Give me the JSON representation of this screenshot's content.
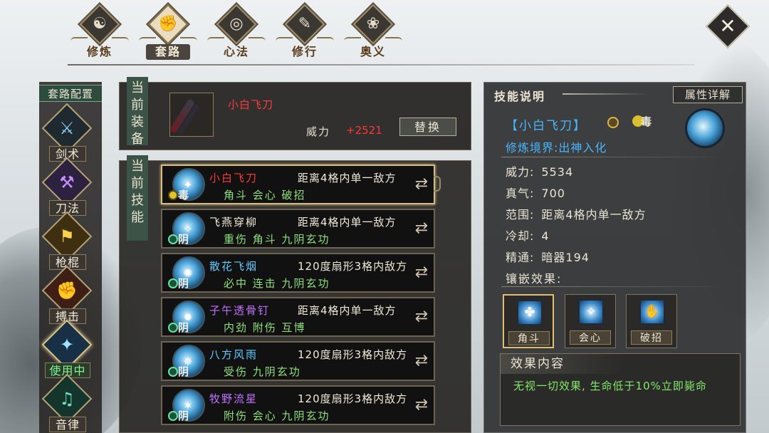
{
  "top_tabs": [
    {
      "label": "修炼",
      "icon": "☯",
      "active": false
    },
    {
      "label": "套路",
      "icon": "✊",
      "active": true
    },
    {
      "label": "心法",
      "icon": "◎",
      "active": false
    },
    {
      "label": "修行",
      "icon": "✎",
      "active": false
    },
    {
      "label": "奥义",
      "icon": "❀",
      "active": false
    }
  ],
  "close_icon": "✕",
  "sidebar": {
    "title": "套路配置",
    "categories": [
      {
        "label": "剑术",
        "icon": "⚔",
        "status": "normal"
      },
      {
        "label": "刀法",
        "icon": "⚒",
        "status": "normal"
      },
      {
        "label": "枪棍",
        "icon": "⚑",
        "status": "normal"
      },
      {
        "label": "搏击",
        "icon": "✊",
        "status": "normal"
      },
      {
        "label": "使用中",
        "icon": "✦",
        "status": "using"
      },
      {
        "label": "音律",
        "icon": "♫",
        "status": "normal"
      }
    ]
  },
  "equipment": {
    "vertical_label": "当前装备",
    "weapon_name": "小白飞刀",
    "power_label": "威力",
    "power_value": "+2521",
    "replace_button": "替换"
  },
  "skills": {
    "vertical_label": "当前技能",
    "items": [
      {
        "name": "小白飞刀",
        "name_color": "#ff3b3b",
        "range": "距离4格内单一敌方",
        "tags": "角斗 会心 破招",
        "badge": "毒",
        "selected": true
      },
      {
        "name": "飞燕穿柳",
        "name_color": "#f0ead8",
        "range": "距离4格内单一敌方",
        "tags": "重伤 角斗 九阴玄功",
        "badge": "阴",
        "selected": false
      },
      {
        "name": "散花飞烟",
        "name_color": "#63c9ff",
        "range": "120度扇形3格内敌方",
        "tags": "必中 连击 九阴玄功",
        "badge": "阴",
        "selected": false
      },
      {
        "name": "子午透骨钉",
        "name_color": "#c071ff",
        "range": "距离4格内单一敌方",
        "tags": "内劲 附伤 互博",
        "badge": "阴",
        "selected": false
      },
      {
        "name": "八方风雨",
        "name_color": "#63c9ff",
        "range": "120度扇形3格内敌方",
        "tags": "受伤 九阴玄功",
        "badge": "阴",
        "selected": false
      },
      {
        "name": "牧野流星",
        "name_color": "#c071ff",
        "range": "120度扇形3格内敌方",
        "tags": "附伤 会心 九阴玄功",
        "badge": "阴",
        "selected": false
      }
    ]
  },
  "detail": {
    "header": "技能说明",
    "attr_button": "属性详解",
    "skill_name": "【小白飞刀】",
    "poison_badge": "毒",
    "realm": "修炼境界:出神入化",
    "stats": [
      {
        "label": "威力:",
        "value": "5534"
      },
      {
        "label": "真气:",
        "value": "700"
      },
      {
        "label": "范围:",
        "value": "距离4格内单一敌方"
      },
      {
        "label": "冷却:",
        "value": "4"
      },
      {
        "label": "精通:",
        "value": "暗器194"
      }
    ],
    "inlay_title": "镶嵌效果:",
    "inlays": [
      {
        "label": "角斗",
        "icon": "✤",
        "selected": true
      },
      {
        "label": "会心",
        "icon": "✧",
        "selected": false
      },
      {
        "label": "破招",
        "icon": "✋",
        "selected": false
      }
    ],
    "effect_title": "效果内容",
    "effect_text": "无视一切效果, 生命低于10%立即毙命"
  }
}
